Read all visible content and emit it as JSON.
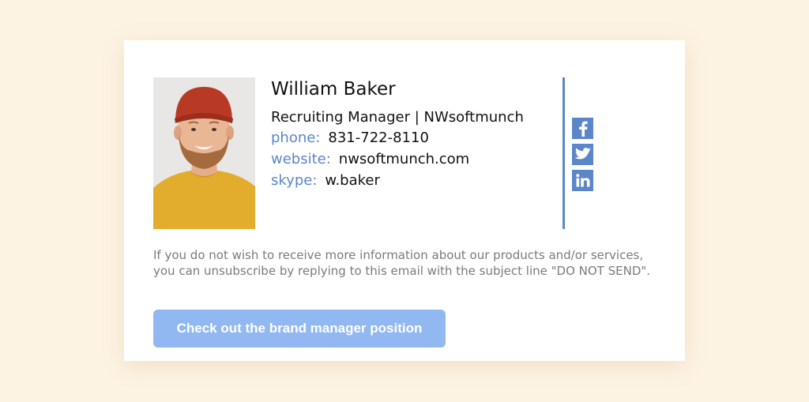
{
  "signature": {
    "name": "William Baker",
    "title": "Recruiting Manager | NWsoftmunch",
    "contacts": [
      {
        "label": "phone:",
        "value": "831-722-8110"
      },
      {
        "label": "website:",
        "value": "nwsoftmunch.com"
      },
      {
        "label": "skype:",
        "value": "w.baker"
      }
    ],
    "photo": "portrait-photo",
    "socials": [
      "facebook-icon",
      "twitter-icon",
      "linkedin-icon"
    ]
  },
  "disclaimer": "If you do not wish to receive more information about our products and/or services, you can unsubscribe by replying to this email with the subject line \"DO NOT SEND\".",
  "cta": {
    "label": "Check out the brand manager position"
  },
  "colors": {
    "background": "#fdf3e3",
    "card": "#ffffff",
    "accent": "#5b86c9",
    "button": "#92b8f2",
    "muted_text": "#7b7b7b",
    "text": "#111111"
  }
}
